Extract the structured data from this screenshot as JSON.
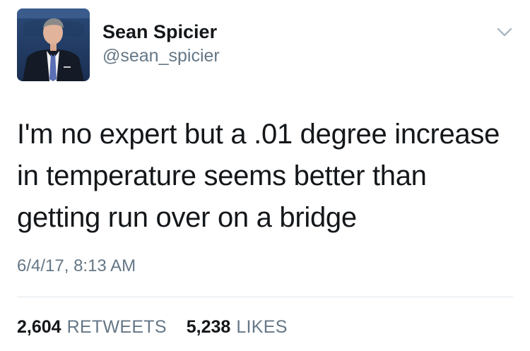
{
  "tweet": {
    "author": {
      "display_name": "Sean Spicier",
      "handle": "@sean_spicier"
    },
    "text": "I'm no expert but a .01 degree increase in temperature seems better than getting run over on a bridge",
    "timestamp": "6/4/17, 8:13 AM",
    "stats": {
      "retweets_count": "2,604",
      "retweets_label": "RETWEETS",
      "likes_count": "5,238",
      "likes_label": "LIKES"
    },
    "menu_icon": "chevron-down-icon",
    "colors": {
      "text": "#14171a",
      "secondary_text": "#657786",
      "divider": "#e1e8ed",
      "chevron": "#aab8c2"
    }
  }
}
